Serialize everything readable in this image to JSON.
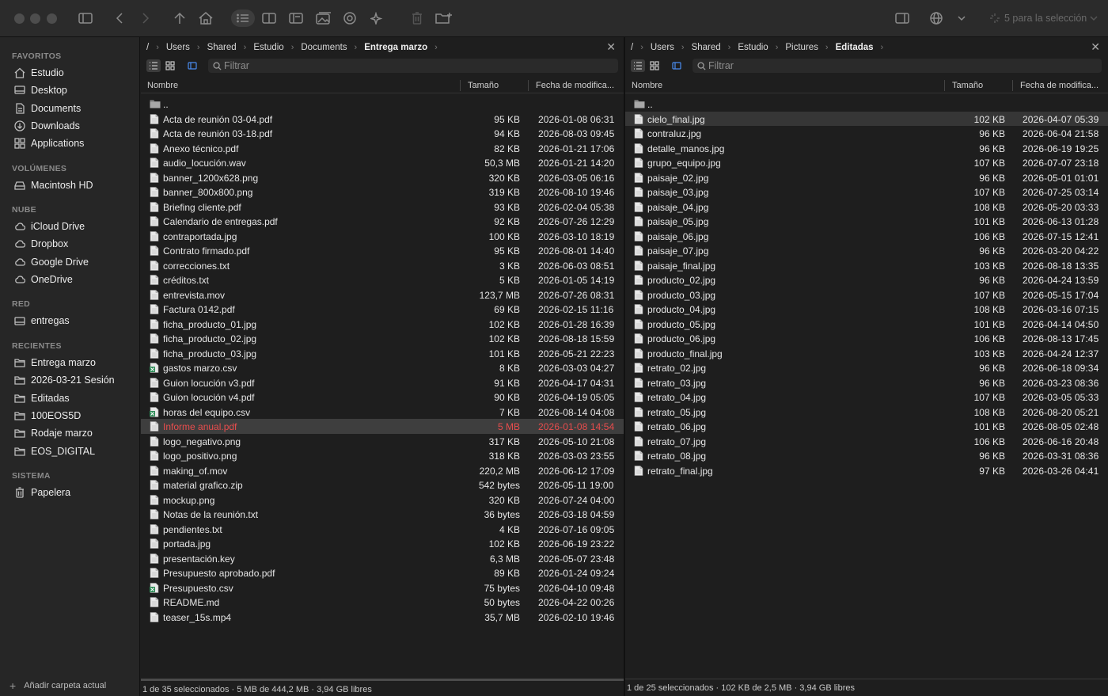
{
  "toolbar": {
    "selection_label": "5 para la selección"
  },
  "sidebar": {
    "sections": [
      {
        "title": "FAVORITOS",
        "items": [
          {
            "label": "Estudio",
            "icon": "home-icon"
          },
          {
            "label": "Desktop",
            "icon": "desktop-icon"
          },
          {
            "label": "Documents",
            "icon": "document-icon"
          },
          {
            "label": "Downloads",
            "icon": "download-icon"
          },
          {
            "label": "Applications",
            "icon": "applications-icon"
          }
        ]
      },
      {
        "title": "VOLÚMENES",
        "items": [
          {
            "label": "Macintosh HD",
            "icon": "drive-icon"
          }
        ]
      },
      {
        "title": "NUBE",
        "items": [
          {
            "label": "iCloud Drive",
            "icon": "cloud-icon"
          },
          {
            "label": "Dropbox",
            "icon": "cloud-icon"
          },
          {
            "label": "Google Drive",
            "icon": "cloud-icon"
          },
          {
            "label": "OneDrive",
            "icon": "cloud-icon"
          }
        ]
      },
      {
        "title": "RED",
        "items": [
          {
            "label": "entregas",
            "icon": "network-drive-icon"
          }
        ]
      },
      {
        "title": "RECIENTES",
        "items": [
          {
            "label": "Entrega marzo",
            "icon": "folder-icon"
          },
          {
            "label": "2026-03-21 Sesión",
            "icon": "folder-icon"
          },
          {
            "label": "Editadas",
            "icon": "folder-icon"
          },
          {
            "label": "100EOS5D",
            "icon": "folder-icon"
          },
          {
            "label": "Rodaje marzo",
            "icon": "folder-icon"
          },
          {
            "label": "EOS_DIGITAL",
            "icon": "folder-icon"
          }
        ]
      },
      {
        "title": "SISTEMA",
        "items": [
          {
            "label": "Papelera",
            "icon": "trash-icon"
          }
        ]
      }
    ],
    "footer_label": "Añadir carpeta actual"
  },
  "left_pane": {
    "breadcrumb": [
      "/",
      "Users",
      "Shared",
      "Estudio",
      "Documents",
      "Entrega marzo"
    ],
    "filter_placeholder": "Filtrar",
    "columns": {
      "name": "Nombre",
      "size": "Tamaño",
      "date": "Fecha de modifica..."
    },
    "parent": "..",
    "files": [
      {
        "name": "Acta de reunión 03-04.pdf",
        "size": "95 KB",
        "date": "2026-01-08 06:31",
        "type": "doc"
      },
      {
        "name": "Acta de reunión 03-18.pdf",
        "size": "94 KB",
        "date": "2026-08-03 09:45",
        "type": "doc"
      },
      {
        "name": "Anexo técnico.pdf",
        "size": "82 KB",
        "date": "2026-01-21 17:06",
        "type": "doc"
      },
      {
        "name": "audio_locución.wav",
        "size": "50,3 MB",
        "date": "2026-01-21 14:20",
        "type": "doc"
      },
      {
        "name": "banner_1200x628.png",
        "size": "320 KB",
        "date": "2026-03-05 06:16",
        "type": "doc"
      },
      {
        "name": "banner_800x800.png",
        "size": "319 KB",
        "date": "2026-08-10 19:46",
        "type": "doc"
      },
      {
        "name": "Briefing cliente.pdf",
        "size": "93 KB",
        "date": "2026-02-04 05:38",
        "type": "doc"
      },
      {
        "name": "Calendario de entregas.pdf",
        "size": "92 KB",
        "date": "2026-07-26 12:29",
        "type": "doc"
      },
      {
        "name": "contraportada.jpg",
        "size": "100 KB",
        "date": "2026-03-10 18:19",
        "type": "doc"
      },
      {
        "name": "Contrato firmado.pdf",
        "size": "95 KB",
        "date": "2026-08-01 14:40",
        "type": "doc"
      },
      {
        "name": "correcciones.txt",
        "size": "3 KB",
        "date": "2026-06-03 08:51",
        "type": "doc"
      },
      {
        "name": "créditos.txt",
        "size": "5 KB",
        "date": "2026-01-05 14:19",
        "type": "doc"
      },
      {
        "name": "entrevista.mov",
        "size": "123,7 MB",
        "date": "2026-07-26 08:31",
        "type": "doc"
      },
      {
        "name": "Factura 0142.pdf",
        "size": "69 KB",
        "date": "2026-02-15 11:16",
        "type": "doc"
      },
      {
        "name": "ficha_producto_01.jpg",
        "size": "102 KB",
        "date": "2026-01-28 16:39",
        "type": "doc"
      },
      {
        "name": "ficha_producto_02.jpg",
        "size": "102 KB",
        "date": "2026-08-18 15:59",
        "type": "doc"
      },
      {
        "name": "ficha_producto_03.jpg",
        "size": "101 KB",
        "date": "2026-05-21 22:23",
        "type": "doc"
      },
      {
        "name": "gastos marzo.csv",
        "size": "8 KB",
        "date": "2026-03-03 04:27",
        "type": "sheet"
      },
      {
        "name": "Guion locución v3.pdf",
        "size": "91 KB",
        "date": "2026-04-17 04:31",
        "type": "doc"
      },
      {
        "name": "Guion locución v4.pdf",
        "size": "90 KB",
        "date": "2026-04-19 05:05",
        "type": "doc"
      },
      {
        "name": "horas del equipo.csv",
        "size": "7 KB",
        "date": "2026-08-14 04:08",
        "type": "sheet"
      },
      {
        "name": "Informe anual.pdf",
        "size": "5 MB",
        "date": "2026-01-08 14:54",
        "type": "doc",
        "selected": true
      },
      {
        "name": "logo_negativo.png",
        "size": "317 KB",
        "date": "2026-05-10 21:08",
        "type": "doc"
      },
      {
        "name": "logo_positivo.png",
        "size": "318 KB",
        "date": "2026-03-03 23:55",
        "type": "doc"
      },
      {
        "name": "making_of.mov",
        "size": "220,2 MB",
        "date": "2026-06-12 17:09",
        "type": "doc"
      },
      {
        "name": "material grafico.zip",
        "size": "542 bytes",
        "date": "2026-05-11 19:00",
        "type": "doc"
      },
      {
        "name": "mockup.png",
        "size": "320 KB",
        "date": "2026-07-24 04:00",
        "type": "doc"
      },
      {
        "name": "Notas de la reunión.txt",
        "size": "36 bytes",
        "date": "2026-03-18 04:59",
        "type": "doc"
      },
      {
        "name": "pendientes.txt",
        "size": "4 KB",
        "date": "2026-07-16 09:05",
        "type": "doc"
      },
      {
        "name": "portada.jpg",
        "size": "102 KB",
        "date": "2026-06-19 23:22",
        "type": "doc"
      },
      {
        "name": "presentación.key",
        "size": "6,3 MB",
        "date": "2026-05-07 23:48",
        "type": "doc"
      },
      {
        "name": "Presupuesto aprobado.pdf",
        "size": "89 KB",
        "date": "2026-01-24 09:24",
        "type": "doc"
      },
      {
        "name": "Presupuesto.csv",
        "size": "75 bytes",
        "date": "2026-04-10 09:48",
        "type": "sheet"
      },
      {
        "name": "README.md",
        "size": "50 bytes",
        "date": "2026-04-22 00:26",
        "type": "doc"
      },
      {
        "name": "teaser_15s.mp4",
        "size": "35,7 MB",
        "date": "2026-02-10 19:46",
        "type": "doc"
      }
    ],
    "status": "1 de 35 seleccionados · 5 MB de 444,2 MB · 3,94 GB libres"
  },
  "right_pane": {
    "breadcrumb": [
      "/",
      "Users",
      "Shared",
      "Estudio",
      "Pictures",
      "Editadas"
    ],
    "filter_placeholder": "Filtrar",
    "columns": {
      "name": "Nombre",
      "size": "Tamaño",
      "date": "Fecha de modifica..."
    },
    "parent": "..",
    "files": [
      {
        "name": "cielo_final.jpg",
        "size": "102 KB",
        "date": "2026-04-07 05:39",
        "type": "doc",
        "highlighted": true
      },
      {
        "name": "contraluz.jpg",
        "size": "96 KB",
        "date": "2026-06-04 21:58",
        "type": "doc"
      },
      {
        "name": "detalle_manos.jpg",
        "size": "96 KB",
        "date": "2026-06-19 19:25",
        "type": "doc"
      },
      {
        "name": "grupo_equipo.jpg",
        "size": "107 KB",
        "date": "2026-07-07 23:18",
        "type": "doc"
      },
      {
        "name": "paisaje_02.jpg",
        "size": "96 KB",
        "date": "2026-05-01 01:01",
        "type": "doc"
      },
      {
        "name": "paisaje_03.jpg",
        "size": "107 KB",
        "date": "2026-07-25 03:14",
        "type": "doc"
      },
      {
        "name": "paisaje_04.jpg",
        "size": "108 KB",
        "date": "2026-05-20 03:33",
        "type": "doc"
      },
      {
        "name": "paisaje_05.jpg",
        "size": "101 KB",
        "date": "2026-06-13 01:28",
        "type": "doc"
      },
      {
        "name": "paisaje_06.jpg",
        "size": "106 KB",
        "date": "2026-07-15 12:41",
        "type": "doc"
      },
      {
        "name": "paisaje_07.jpg",
        "size": "96 KB",
        "date": "2026-03-20 04:22",
        "type": "doc"
      },
      {
        "name": "paisaje_final.jpg",
        "size": "103 KB",
        "date": "2026-08-18 13:35",
        "type": "doc"
      },
      {
        "name": "producto_02.jpg",
        "size": "96 KB",
        "date": "2026-04-24 13:59",
        "type": "doc"
      },
      {
        "name": "producto_03.jpg",
        "size": "107 KB",
        "date": "2026-05-15 17:04",
        "type": "doc"
      },
      {
        "name": "producto_04.jpg",
        "size": "108 KB",
        "date": "2026-03-16 07:15",
        "type": "doc"
      },
      {
        "name": "producto_05.jpg",
        "size": "101 KB",
        "date": "2026-04-14 04:50",
        "type": "doc"
      },
      {
        "name": "producto_06.jpg",
        "size": "106 KB",
        "date": "2026-08-13 17:45",
        "type": "doc"
      },
      {
        "name": "producto_final.jpg",
        "size": "103 KB",
        "date": "2026-04-24 12:37",
        "type": "doc"
      },
      {
        "name": "retrato_02.jpg",
        "size": "96 KB",
        "date": "2026-06-18 09:34",
        "type": "doc"
      },
      {
        "name": "retrato_03.jpg",
        "size": "96 KB",
        "date": "2026-03-23 08:36",
        "type": "doc"
      },
      {
        "name": "retrato_04.jpg",
        "size": "107 KB",
        "date": "2026-03-05 05:33",
        "type": "doc"
      },
      {
        "name": "retrato_05.jpg",
        "size": "108 KB",
        "date": "2026-08-20 05:21",
        "type": "doc"
      },
      {
        "name": "retrato_06.jpg",
        "size": "101 KB",
        "date": "2026-08-05 02:48",
        "type": "doc"
      },
      {
        "name": "retrato_07.jpg",
        "size": "106 KB",
        "date": "2026-06-16 20:48",
        "type": "doc"
      },
      {
        "name": "retrato_08.jpg",
        "size": "96 KB",
        "date": "2026-03-31 08:36",
        "type": "doc"
      },
      {
        "name": "retrato_final.jpg",
        "size": "97 KB",
        "date": "2026-03-26 04:41",
        "type": "doc"
      }
    ],
    "status": "1 de 25 seleccionados · 102 KB de 2,5 MB · 3,94 GB libres"
  },
  "colors": {
    "window_bg": "#1e1e1e",
    "sidebar_bg": "#262626",
    "toolbar_bg": "#2b2b2b",
    "selected_text": "#e84d4d",
    "accent_blue": "#4a8cf0"
  }
}
